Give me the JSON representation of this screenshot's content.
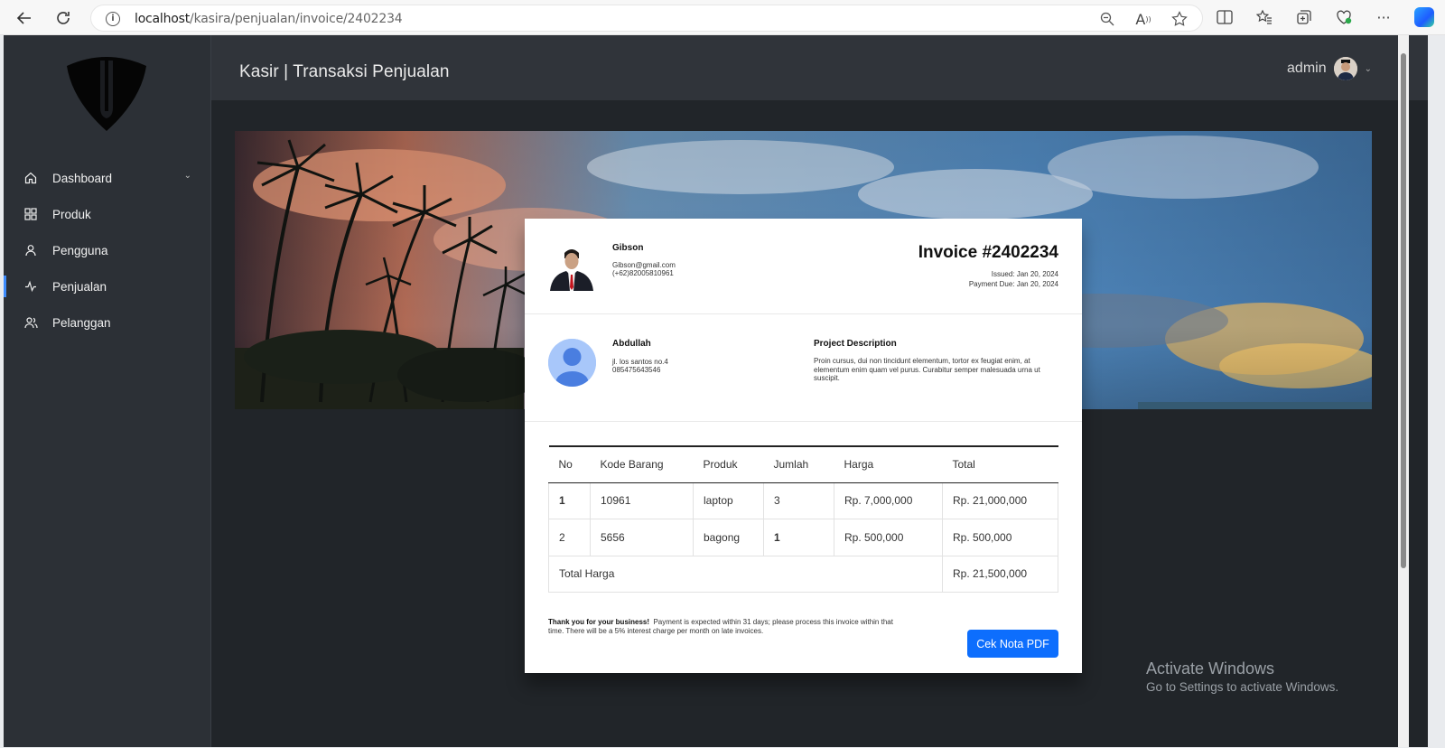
{
  "browser": {
    "url_host": "localhost",
    "url_path": "/kasira/penjualan/invoice/2402234"
  },
  "app": {
    "title": "Kasir | Transaksi Penjualan",
    "user_name": "admin"
  },
  "sidebar": {
    "items": [
      {
        "label": "Dashboard",
        "icon": "home-icon"
      },
      {
        "label": "Produk",
        "icon": "grid-icon"
      },
      {
        "label": "Pengguna",
        "icon": "user-icon"
      },
      {
        "label": "Penjualan",
        "icon": "activity-icon"
      },
      {
        "label": "Pelanggan",
        "icon": "users-icon"
      }
    ]
  },
  "invoice": {
    "seller": {
      "name": "Gibson",
      "email": "Gibson@gmail.com",
      "phone": "(+62)82005810961"
    },
    "title": "Invoice #2402234",
    "issued": "Issued: Jan 20, 2024",
    "due": "Payment Due: Jan 20, 2024",
    "client": {
      "name": "Abdullah",
      "address": "jl. los santos no.4",
      "phone": "085475643546"
    },
    "project": {
      "heading": "Project Description",
      "text": "Proin cursus, dui non tincidunt elementum, tortor ex feugiat enim, at elementum enim quam vel purus. Curabitur semper malesuada urna ut suscipit."
    },
    "table": {
      "headers": [
        "No",
        "Kode Barang",
        "Produk",
        "Jumlah",
        "Harga",
        "Total"
      ],
      "rows": [
        [
          "1",
          "10961",
          "laptop",
          "3",
          "Rp. 7,000,000",
          "Rp. 21,000,000"
        ],
        [
          "2",
          "5656",
          "bagong",
          "1",
          "Rp. 500,000",
          "Rp. 500,000"
        ]
      ],
      "total_label": "Total Harga",
      "total_value": "Rp. 21,500,000"
    },
    "thanks_bold": "Thank you for your business!",
    "thanks_text": "Payment is expected within 31 days; please process this invoice within that time. There will be a 5% interest charge per month on late invoices.",
    "button": "Cek Nota PDF"
  },
  "watermark": {
    "line1": "Activate Windows",
    "line2": "Go to Settings to activate Windows."
  }
}
